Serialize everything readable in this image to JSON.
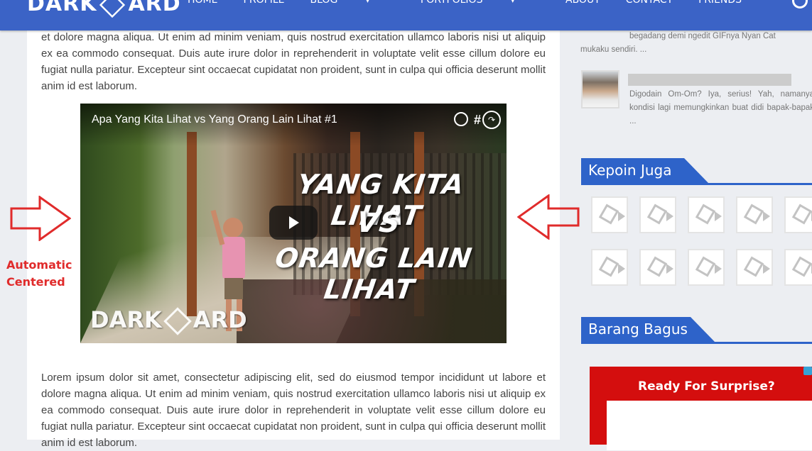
{
  "header": {
    "logo_text_left": "DARK",
    "logo_text_right": "ARD",
    "nav": [
      "HOME",
      "PROFILE",
      "BLOG",
      "PORTFOLIOS",
      "ABOUT",
      "CONTACT",
      "FRIENDS"
    ]
  },
  "main": {
    "paragraph_top": "et dolore magna aliqua. Ut enim ad minim veniam, quis nostrud exercitation ullamco laboris nisi ut aliquip ex ea commodo consequat. Duis aute irure dolor in reprehenderit in voluptate velit esse cillum dolore eu fugiat nulla pariatur. Excepteur sint occaecat cupidatat non proident, sunt in culpa qui officia deserunt mollit anim id est laborum.",
    "paragraph_bottom": "Lorem ipsum dolor sit amet, consectetur adipiscing elit, sed do eiusmod tempor incididunt ut labore et dolore magna aliqua. Ut enim ad minim veniam, quis nostrud exercitation ullamco laboris nisi ut aliquip ex ea commodo consequat. Duis aute irure dolor in reprehenderit in voluptate velit esse cillum dolore eu fugiat nulla pariatur. Excepteur sint occaecat cupidatat non proident, sunt in culpa qui officia deserunt mollit anim id est laborum.",
    "video": {
      "title": "Apa Yang Kita Lihat vs Yang Orang Lain Lihat #1",
      "hash": "#",
      "overlay_line1": "YANG KITA LIHAT",
      "overlay_line2": "VS",
      "overlay_line3": "ORANG LAIN LIHAT",
      "logo_left": "DARK",
      "logo_right": "ARD"
    },
    "annotation": {
      "line1": "Automatic",
      "line2": "Centered",
      "color": "#e02b2b"
    }
  },
  "sidebar": {
    "comment1_line1": "begadang demi ngedit GIFnya Nyan Cat",
    "comment1_line2": "mukaku sendiri. ...",
    "comment2": "Digodain Om-Om? Iya, serius! Yah, namanya kondisi lagi memungkinkan buat didi bapak-bapak ...",
    "widget1_title": "Kepoin Juga",
    "widget2_title": "Barang Bagus",
    "ad_title": "Ready For Surprise?"
  },
  "colors": {
    "nav_bg": "#3b63c6",
    "widget_blue": "#2e63c9",
    "ad_red": "#d40e0e"
  }
}
